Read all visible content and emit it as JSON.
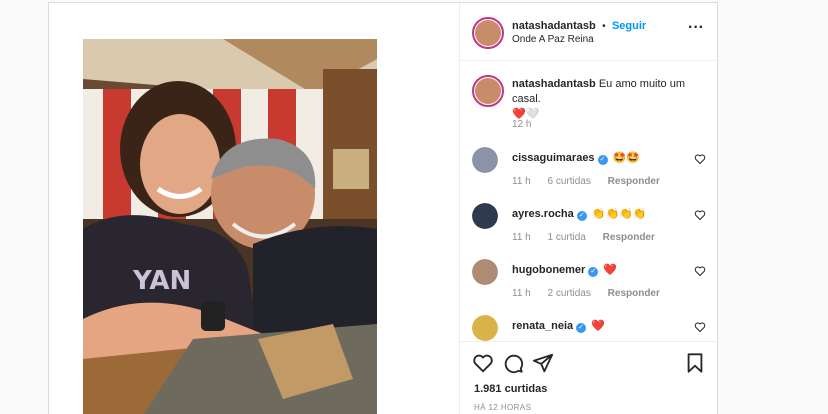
{
  "post": {
    "author": "natashadantasb",
    "separator": "•",
    "follow_label": "Seguir",
    "location": "Onde A Paz Reina",
    "caption_user": "natashadantasb",
    "caption_text": "Eu amo muito um casal.",
    "caption_emoji": "❤️🤍",
    "caption_time": "12 h",
    "likes": "1.981 curtidas",
    "posted_ago": "HÁ 12 HORAS"
  },
  "comments": [
    {
      "user": "cissaguimaraes",
      "verified": true,
      "text": "🤩🤩",
      "time": "11 h",
      "likes": "6 curtidas",
      "reply": "Responder",
      "avatar_color": "#8a94a6"
    },
    {
      "user": "ayres.rocha",
      "verified": true,
      "text": "👏👏👏👏",
      "time": "11 h",
      "likes": "1 curtida",
      "reply": "Responder",
      "avatar_color": "#2f3a4f"
    },
    {
      "user": "hugobonemer",
      "verified": true,
      "text": "❤️",
      "time": "11 h",
      "likes": "2 curtidas",
      "reply": "Responder",
      "avatar_color": "#b08b74"
    },
    {
      "user": "renata_neia",
      "verified": true,
      "text": "❤️",
      "time": "",
      "likes": "",
      "reply": "",
      "avatar_color": "#d9b24a"
    }
  ],
  "icons": {
    "like": "heart-outline-icon",
    "comment": "speech-bubble-icon",
    "share": "paper-plane-icon",
    "save": "bookmark-icon",
    "more": "more-options-icon",
    "verified": "verified-badge-icon"
  },
  "colors": {
    "accent": "#0095f6",
    "text": "#262626",
    "muted": "#8e8e8e",
    "verified": "#3897f0"
  }
}
